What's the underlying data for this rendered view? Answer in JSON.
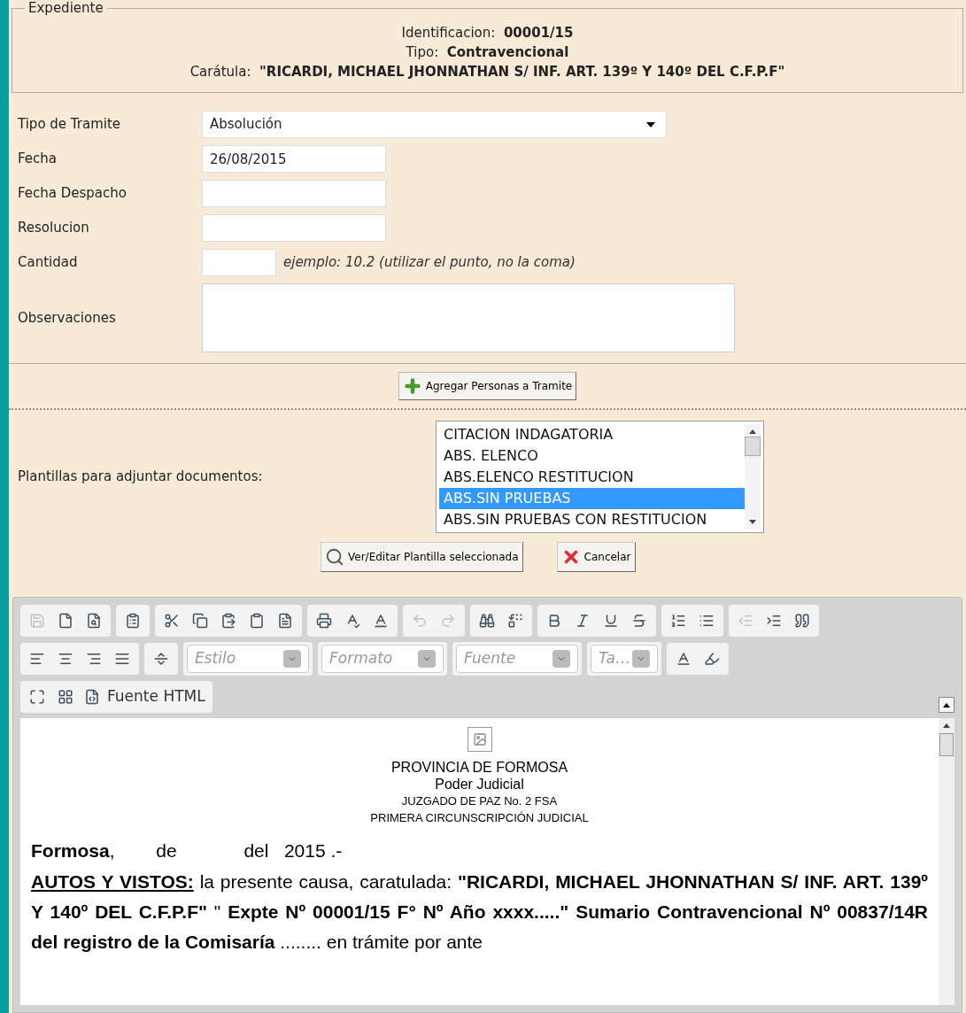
{
  "expediente": {
    "legend": "Expediente",
    "lines": [
      {
        "label": "Identificacion:",
        "value": "00001/15"
      },
      {
        "label": "Tipo:",
        "value": "Contravencional"
      },
      {
        "label": "Carátula:",
        "value": "\"RICARDI, MICHAEL JHONNATHAN S/ INF. ART. 139º Y 140º DEL C.F.P.F\""
      }
    ]
  },
  "form": {
    "fields": [
      {
        "kind": "select",
        "label": "Tipo de Tramite",
        "value": "Absolución"
      },
      {
        "kind": "text",
        "label": "Fecha",
        "value": "26/08/2015"
      },
      {
        "kind": "text",
        "label": "Fecha Despacho"
      },
      {
        "kind": "text",
        "label": "Resolucion"
      },
      {
        "kind": "short",
        "label": "Cantidad",
        "hint": "ejemplo: 10.2 (utilizar el punto, no la coma)"
      },
      {
        "kind": "textarea",
        "label": "Observaciones"
      }
    ]
  },
  "add_button": "Agregar Personas a Tramite",
  "templates": {
    "label": "Plantillas para adjuntar documentos:",
    "items": [
      {
        "label": "CITACION INDAGATORIA",
        "selected": false
      },
      {
        "label": "ABS. ELENCO",
        "selected": false
      },
      {
        "label": "ABS.ELENCO RESTITUCION",
        "selected": false
      },
      {
        "label": "ABS.SIN PRUEBAS",
        "selected": true
      },
      {
        "label": "ABS.SIN PRUEBAS CON RESTITUCION",
        "selected": false
      }
    ],
    "buttons": [
      {
        "kind": "view",
        "label": "Ver/Editar Plantilla seleccionada"
      },
      {
        "kind": "cancel",
        "label": "Cancelar"
      }
    ]
  },
  "editor": {
    "toolbar": [
      [
        [
          {
            "kind": "save",
            "disabled": true
          },
          {
            "kind": "new",
            "disabled": false
          },
          {
            "kind": "preview",
            "disabled": false
          }
        ],
        [
          {
            "kind": "template",
            "disabled": false
          }
        ],
        [
          {
            "kind": "cut",
            "disabled": false
          },
          {
            "kind": "copy",
            "disabled": false
          },
          {
            "kind": "paste",
            "disabled": false
          },
          {
            "kind": "pastetext",
            "disabled": false
          },
          {
            "kind": "pasteword",
            "disabled": false
          }
        ],
        [
          {
            "kind": "print",
            "disabled": false
          },
          {
            "kind": "spell",
            "disabled": false
          },
          {
            "kind": "spellmenu",
            "disabled": false
          }
        ],
        [
          {
            "kind": "undo",
            "disabled": true
          },
          {
            "kind": "redo",
            "disabled": true
          }
        ],
        [
          {
            "kind": "find",
            "disabled": false
          },
          {
            "kind": "replace",
            "disabled": false
          }
        ],
        [
          {
            "kind": "bold",
            "disabled": false
          },
          {
            "kind": "italic",
            "disabled": false
          },
          {
            "kind": "underline",
            "disabled": false
          },
          {
            "kind": "strike",
            "disabled": false
          }
        ],
        [
          {
            "kind": "numbered",
            "disabled": false
          },
          {
            "kind": "bulleted",
            "disabled": false
          }
        ],
        [
          {
            "kind": "outdent",
            "disabled": true
          },
          {
            "kind": "indent",
            "disabled": false
          },
          {
            "kind": "quote",
            "disabled": false
          }
        ]
      ],
      [
        [
          {
            "kind": "left",
            "disabled": false
          },
          {
            "kind": "center",
            "disabled": false
          },
          {
            "kind": "right",
            "disabled": false
          },
          {
            "kind": "justify",
            "disabled": false
          }
        ],
        [
          {
            "kind": "pagebreak",
            "disabled": false
          }
        ],
        [
          {
            "kind": "combo",
            "label": "Estilo"
          }
        ],
        [
          {
            "kind": "combo",
            "label": "Formato"
          }
        ],
        [
          {
            "kind": "combo",
            "label": "Fuente"
          }
        ],
        [
          {
            "kind": "smallcombo",
            "label": "Ta…"
          }
        ],
        [
          {
            "kind": "textcolor",
            "disabled": false
          },
          {
            "kind": "bgcolor",
            "disabled": false
          }
        ]
      ],
      [
        [
          {
            "kind": "maximize",
            "disabled": false
          },
          {
            "kind": "blocks",
            "disabled": false
          },
          {
            "kind": "source",
            "label": "Fuente HTML",
            "disabled": false
          }
        ]
      ]
    ],
    "document": {
      "header": [
        "PROVINCIA DE FORMOSA",
        "Poder Judicial",
        "JUZGADO DE PAZ No. 2 FSA",
        "PRIMERA CIRCUNSCRIPCIÓN JUDICIAL"
      ],
      "date_line": "**Formosa**,        de             del   2015 .-",
      "paragraph": {
        "lead": "AUTOS Y VISTOS:",
        "text": "la presente causa, caratulada: **\"RICARDI, MICHAEL JHONNATHAN S/ INF. ART. 139º Y 140º DEL C.F.P.F\"** \" **Expte Nº   00001/15 F° Nº   Año xxxx.....\" Sumario Contravencional Nº   00837/14R      del registro de la Comisaría** ........ en trámite por ante"
      }
    }
  }
}
